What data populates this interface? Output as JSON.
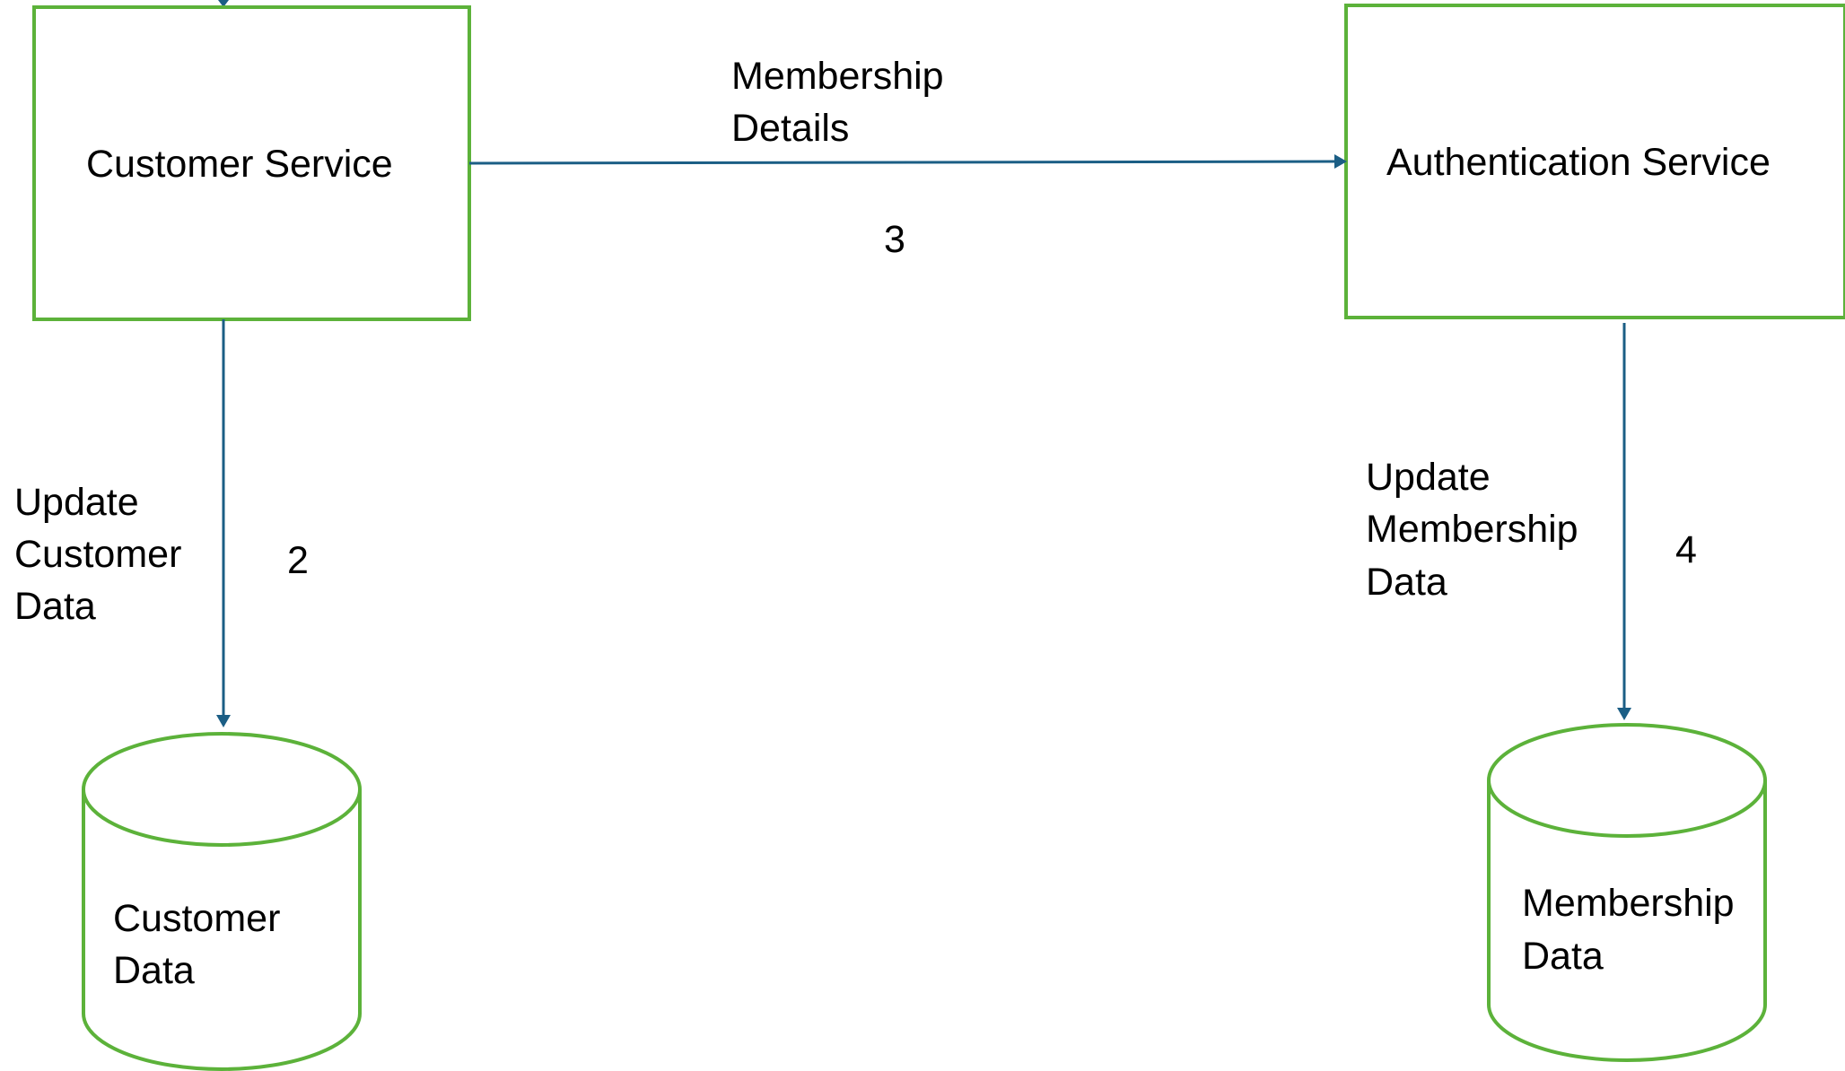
{
  "colors": {
    "node_border": "#5cb23a",
    "arrow": "#1b5e85",
    "text": "#000000"
  },
  "nodes": {
    "customer_service": {
      "label": "Customer Service"
    },
    "authentication_service": {
      "label": "Authentication Service"
    },
    "customer_data": {
      "lines": [
        "Customer",
        "Data"
      ]
    },
    "membership_data": {
      "lines": [
        "Membership",
        "Data"
      ]
    }
  },
  "edges": {
    "membership_details": {
      "lines": [
        "Membership",
        "Details"
      ],
      "step": "3"
    },
    "update_customer_data": {
      "lines": [
        "Update",
        "Customer",
        "Data"
      ],
      "step": "2"
    },
    "update_membership_data": {
      "lines": [
        "Update",
        "Membership",
        "Data"
      ],
      "step": "4"
    }
  }
}
